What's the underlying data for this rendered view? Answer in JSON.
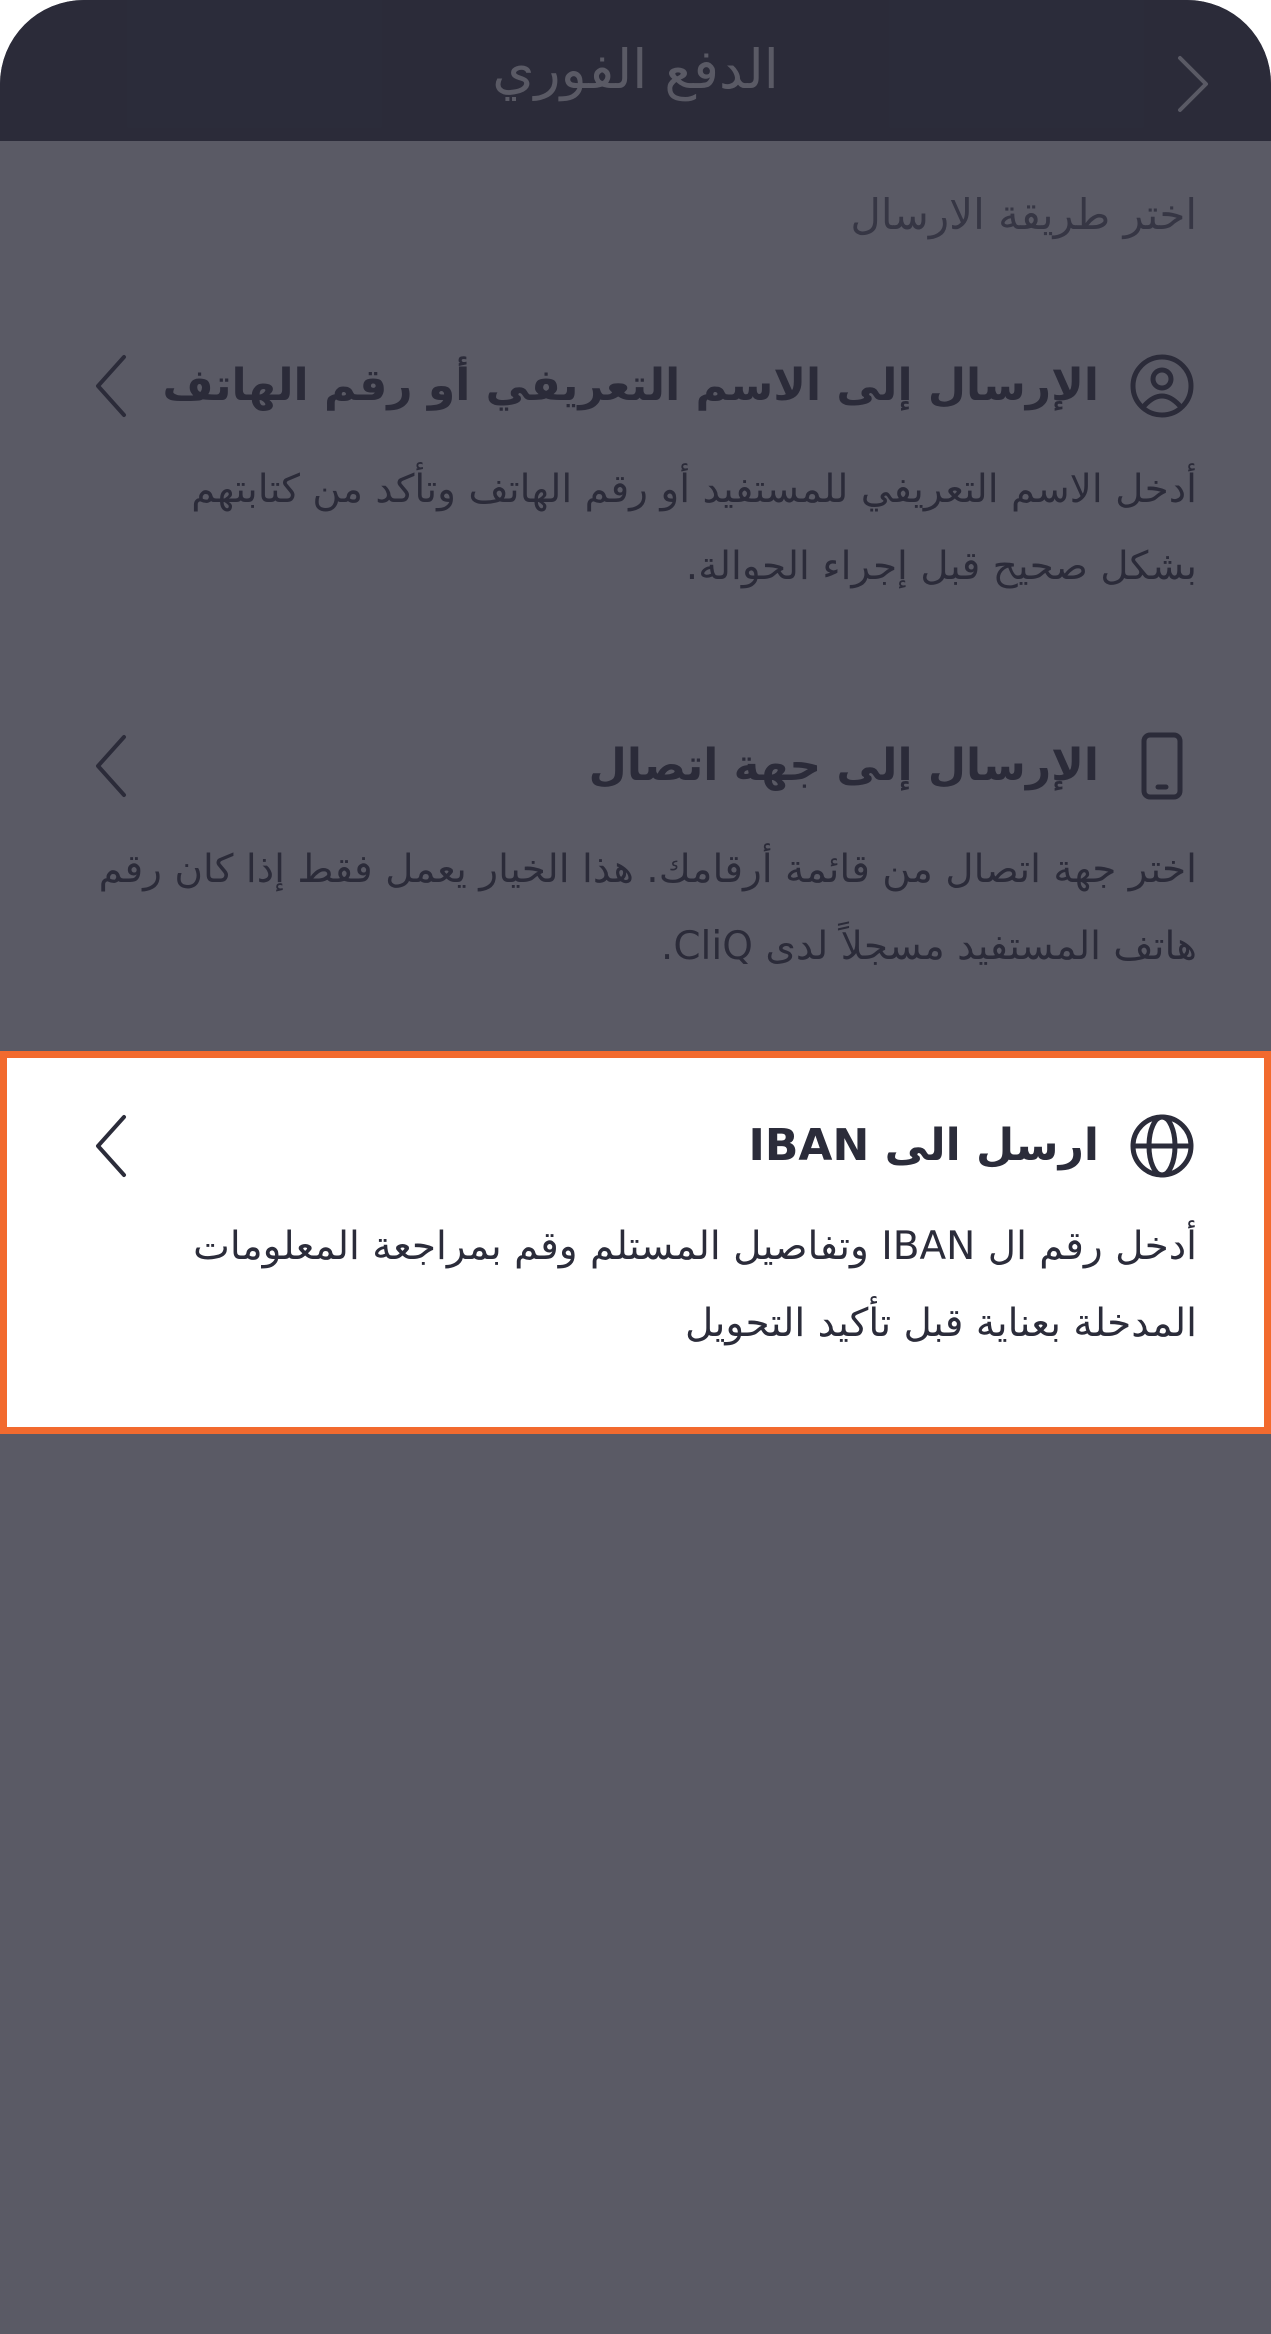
{
  "header": {
    "title": "الدفع الفوري",
    "back_icon": "chevron-right-icon"
  },
  "section_title": "اختر طريقة الارسال",
  "options": [
    {
      "icon": "user-circle-icon",
      "title": "الإرسال إلى الاسم التعريفي أو رقم الهاتف",
      "description": "أدخل الاسم التعريفي للمستفيد أو رقم الهاتف وتأكد من كتابتهم بشكل صحيح قبل إجراء الحوالة."
    },
    {
      "icon": "smartphone-icon",
      "title": "الإرسال إلى جهة اتصال",
      "description": "اختر جهة اتصال من قائمة أرقامك. هذا الخيار يعمل فقط إذا كان رقم هاتف المستفيد مسجلاً لدى CliQ."
    },
    {
      "icon": "globe-icon",
      "title": "ارسل الى IBAN",
      "description": "أدخل رقم ال IBAN وتفاصيل المستلم وقم بمراجعة المعلومات المدخلة بعناية قبل تأكيد التحويل"
    }
  ],
  "colors": {
    "header_bg": "#2b2c3a",
    "text_dark": "#2b2c3a",
    "overlay": "#5c5d6a",
    "highlight_border": "#f26a2e"
  }
}
